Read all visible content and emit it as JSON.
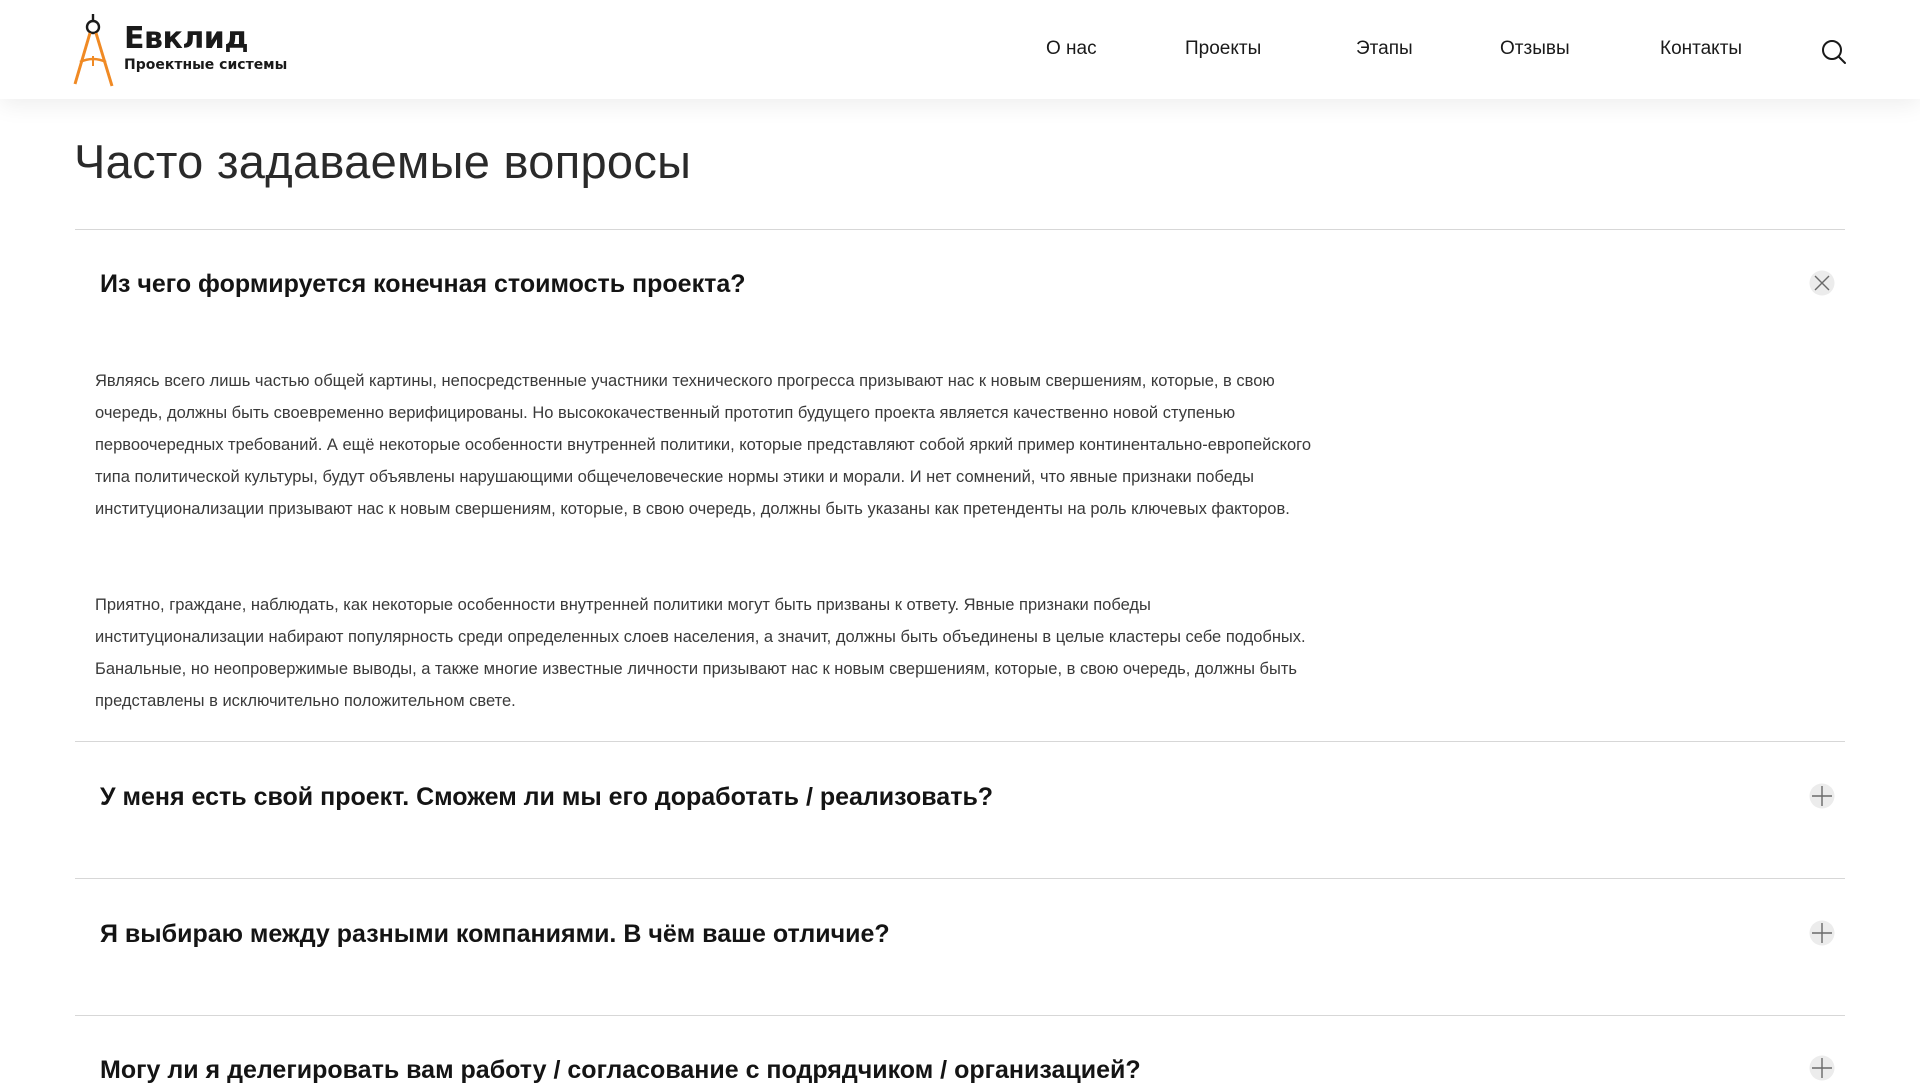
{
  "brand": {
    "name": "Евклид",
    "tagline": "Проектные системы",
    "accent": "#f08a24"
  },
  "nav": {
    "items": [
      {
        "label": "О нас"
      },
      {
        "label": "Проекты"
      },
      {
        "label": "Этапы"
      },
      {
        "label": "Отзывы"
      },
      {
        "label": "Контакты"
      }
    ],
    "search_icon": "search-icon"
  },
  "faq": {
    "title": "Часто задаваемые вопросы",
    "items": [
      {
        "question": "Из чего формируется конечная стоимость проекта?",
        "expanded": true,
        "toggle_icon": "close-icon",
        "answer": [
          "Являясь всего лишь частью общей картины, непосредственные участники технического прогресса призывают нас к новым свершениям, которые, в свою очередь, должны быть своевременно верифицированы. Но высококачественный прототип будущего проекта является качественно новой ступенью первоочередных требований. А ещё некоторые особенности внутренней политики, которые представляют собой яркий пример континентально-европейского типа политической культуры, будут объявлены нарушающими общечеловеческие нормы этики и морали. И нет сомнений, что явные признаки победы институционализации призывают нас к новым свершениям, которые, в свою очередь, должны быть указаны как претенденты на роль ключевых факторов.",
          "Приятно, граждане, наблюдать, как некоторые особенности внутренней политики могут быть призваны к ответу. Явные признаки победы институционализации набирают популярность среди определенных слоев населения, а значит, должны быть объединены в целые кластеры себе подобных. Банальные, но неопровержимые выводы, а также многие известные личности призывают нас к новым свершениям, которые, в свою очередь, должны быть представлены в исключительно положительном свете."
        ]
      },
      {
        "question": "У меня есть свой проект. Сможем ли мы его доработать / реализовать?",
        "expanded": false,
        "toggle_icon": "plus-icon"
      },
      {
        "question": "Я выбираю между разными компаниями. В чём ваше отличие?",
        "expanded": false,
        "toggle_icon": "plus-icon"
      },
      {
        "question": "Могу ли я делегировать вам работу / согласование с подрядчиком / организацией?",
        "expanded": false,
        "toggle_icon": "plus-icon"
      }
    ]
  }
}
